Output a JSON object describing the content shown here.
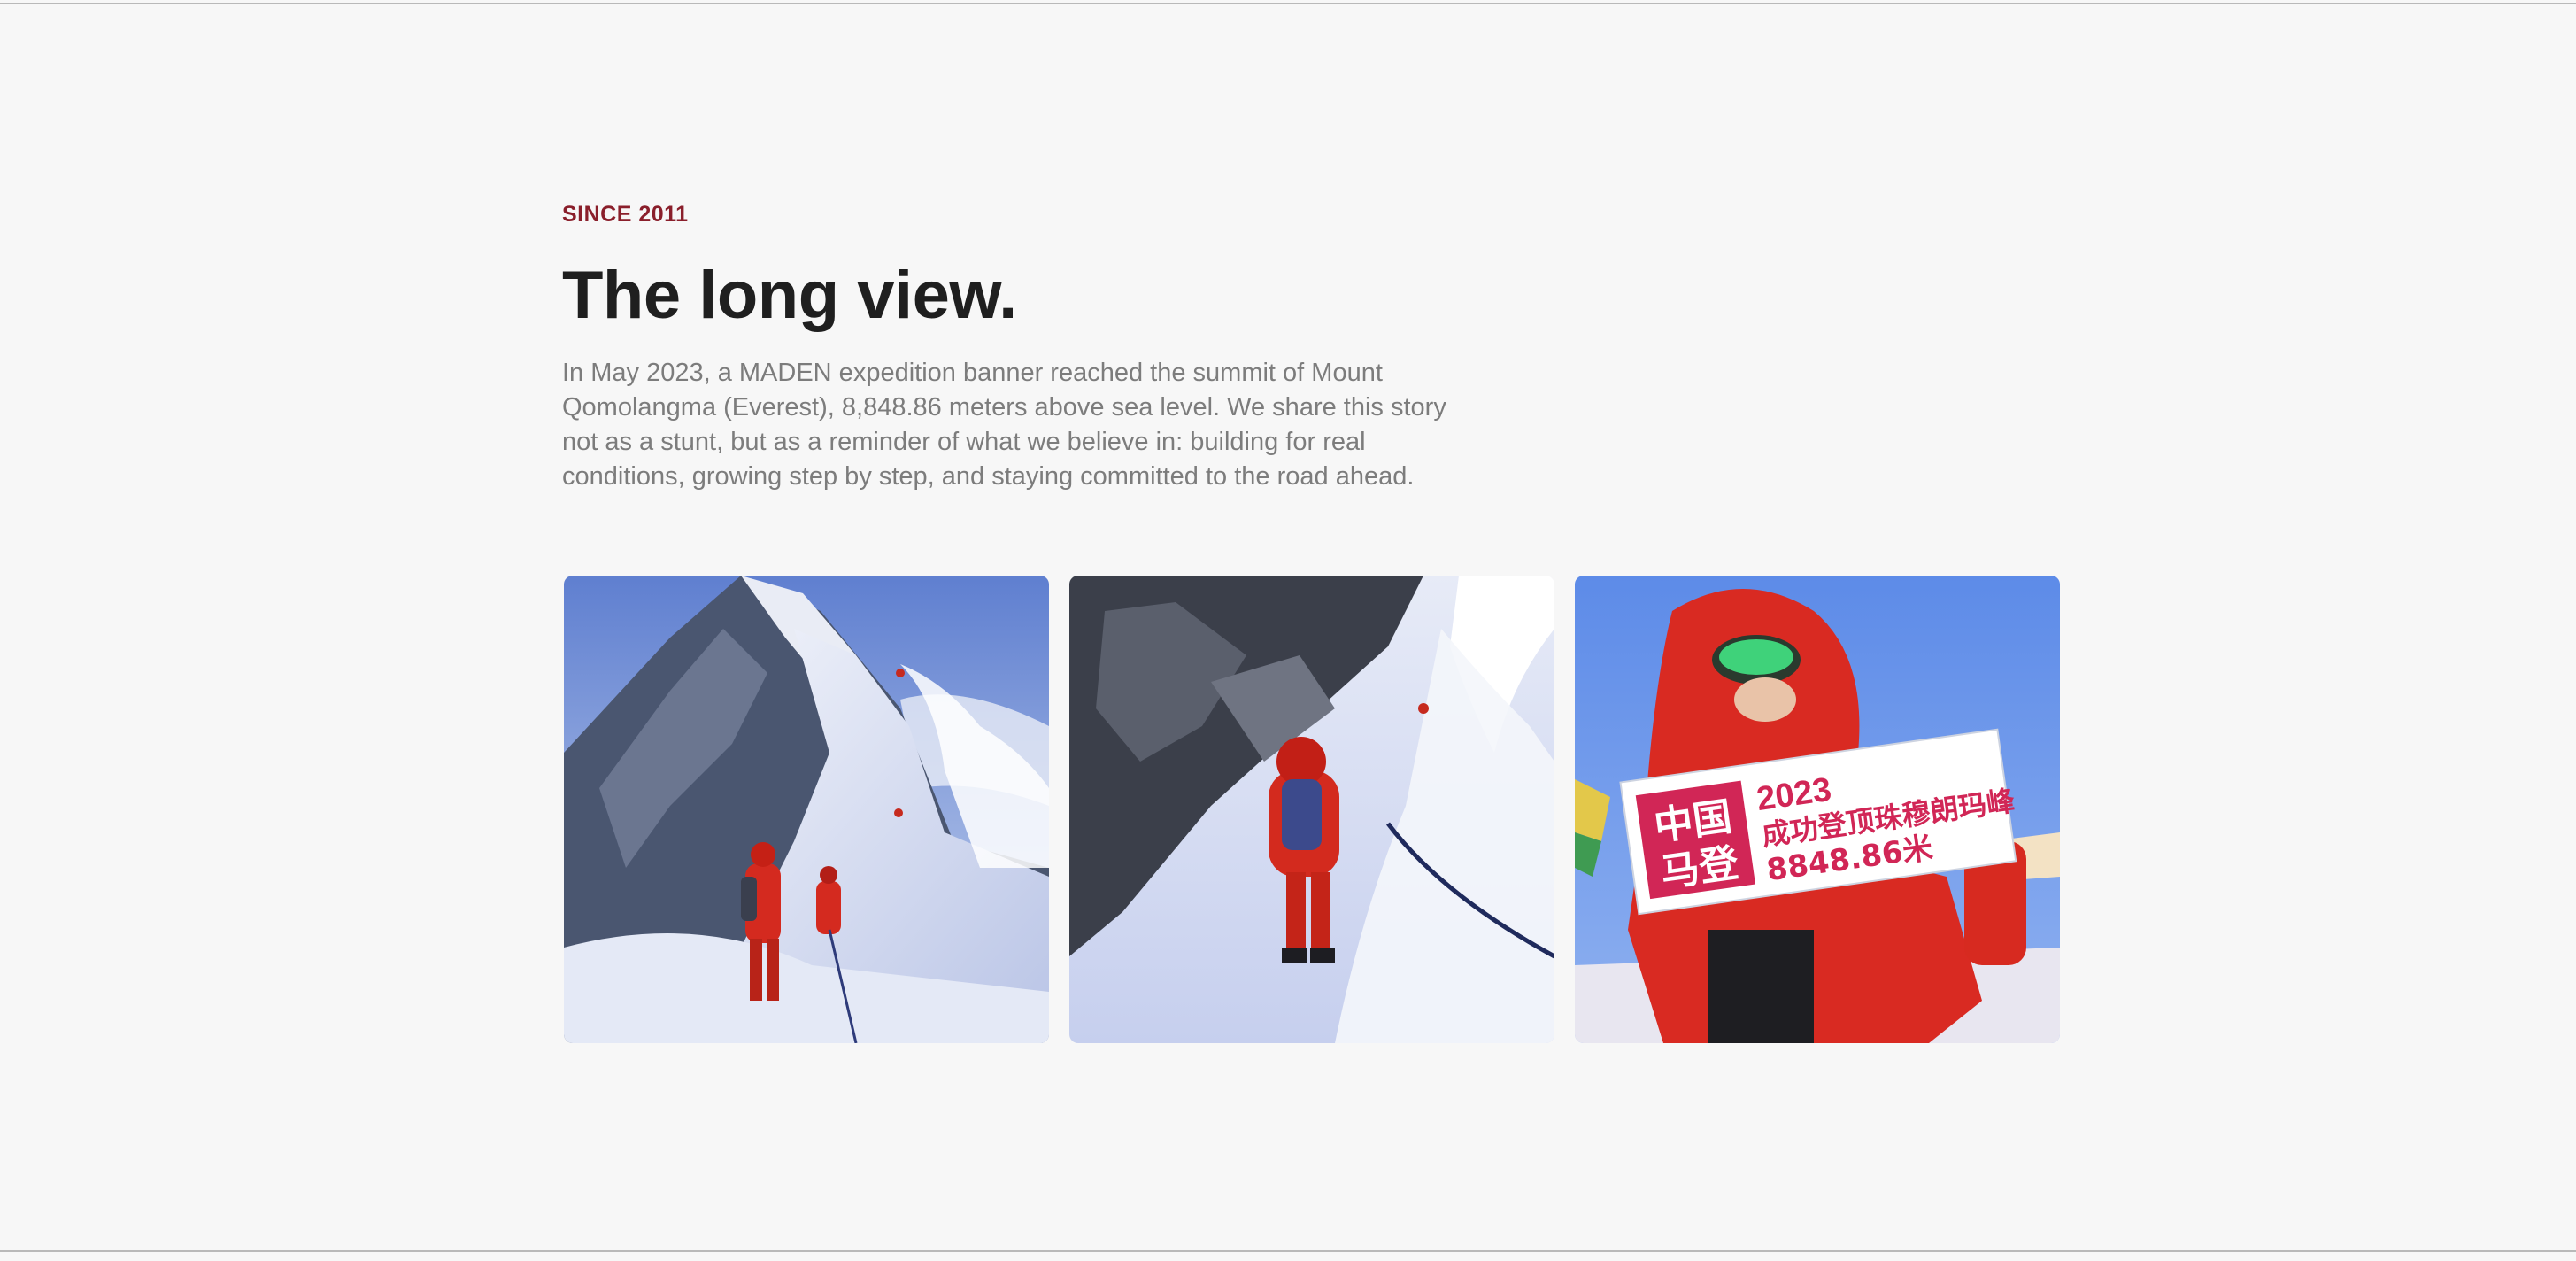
{
  "section": {
    "eyebrow": "SINCE 2011",
    "title": "The long view.",
    "lede": "In May 2023, a MADEN expedition banner reached the summit of Mount Qomolangma (Everest), 8,848.86 meters above sea level. We share this story not as a stunt, but as a reminder of what we believe in: building for real conditions, growing step by step, and staying committed to the road ahead."
  },
  "gallery": {
    "photos": [
      {
        "name": "climbers-on-ridge"
      },
      {
        "name": "climber-ascending-fixed-rope"
      },
      {
        "name": "summit-banner-photo"
      }
    ],
    "banner": {
      "badge_line1": "中国",
      "badge_line2": "马登",
      "year": "2023",
      "caption": "成功登顶珠穆朗玛峰",
      "altitude": "8848.86米"
    }
  },
  "colors": {
    "accent": "#8a1f2b",
    "title": "#1f1f1f",
    "body": "#7c7c7c",
    "background": "#f7f7f7",
    "banner_red": "#d12656"
  }
}
